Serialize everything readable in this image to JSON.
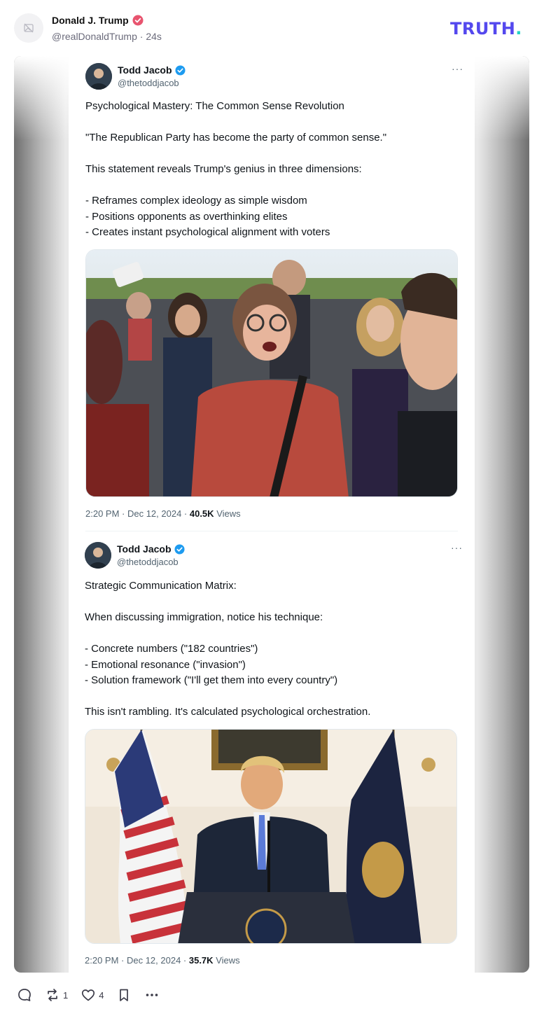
{
  "post": {
    "author_name": "Donald J. Trump",
    "handle": "@realDonaldTrump",
    "time": "24s",
    "brand": "TRUTH"
  },
  "quoted": [
    {
      "name": "Todd Jacob",
      "handle": "@thetoddjacob",
      "more": "···",
      "text": "Psychological Mastery: The Common Sense Revolution\n\n\"The Republican Party has become the party of common sense.\"\n\nThis statement reveals Trump's genius in three dimensions:\n\n- Reframes complex ideology as simple wisdom\n- Positions opponents as overthinking elites\n- Creates instant psychological alignment with voters",
      "time": "2:20 PM · Dec 12, 2024 · ",
      "views_count": "40.5K",
      "views_label": "Views"
    },
    {
      "name": "Todd Jacob",
      "handle": "@thetoddjacob",
      "more": "···",
      "text": "Strategic Communication Matrix:\n\nWhen discussing immigration, notice his technique:\n\n- Concrete numbers (\"182 countries\")\n- Emotional resonance (\"invasion\")\n- Solution framework (\"I'll get them into every country\")\n\nThis isn't rambling. It's calculated psychological orchestration.",
      "time": "2:20 PM · Dec 12, 2024 · ",
      "views_count": "35.7K",
      "views_label": "Views"
    }
  ],
  "actions": {
    "reply_icon": "reply-icon",
    "retruth_icon": "retruth-icon",
    "retruth_count": "1",
    "like_icon": "heart-icon",
    "like_count": "4",
    "bookmark_icon": "bookmark-icon",
    "more_icon": "more-icon"
  },
  "colors": {
    "brand": "#5448ee",
    "brand_dot": "#22d3c5",
    "verified_pink": "#e8546f",
    "verified_blue": "#1d9bf0"
  }
}
